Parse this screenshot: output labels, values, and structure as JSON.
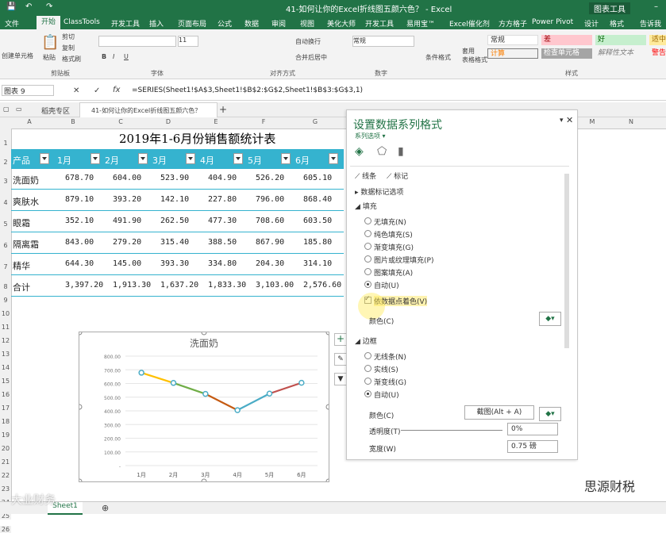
{
  "titlebar": {
    "doc_title": "41-如何让你的Excel折线图五颜六色？ - Excel",
    "context_group": "图表工具"
  },
  "tabs": [
    "文件",
    "开始",
    "ClassTools",
    "开发工具",
    "插入",
    "页面布局",
    "公式",
    "数据",
    "审阅",
    "视图",
    "美化大师",
    "开发工具",
    "易用宝™",
    "Excel催化剂",
    "方方格子",
    "Power Pivot",
    "设计",
    "格式",
    "告诉我"
  ],
  "ribbon": {
    "clipboard": {
      "cut": "剪切",
      "copy": "复制",
      "format_painter": "格式刷",
      "paste": "粘贴",
      "group": "剪贴板",
      "format_brush_left": "创建单元格"
    },
    "font": {
      "size": "11",
      "group": "字体"
    },
    "alignment": {
      "wrap": "自动换行",
      "merge": "合并后居中",
      "group": "对齐方式"
    },
    "number": {
      "format": "常规",
      "group": "数字"
    },
    "styles": {
      "cond": "条件格式",
      "table": "套用\n表格格式",
      "normal": "常规",
      "bad": "差",
      "good": "好",
      "neutral": "适中",
      "calc": "计算",
      "check": "检查单元格",
      "explain": "解释性文本",
      "warn": "警告",
      "group": "样式"
    }
  },
  "formula_bar": {
    "name_box": "图表 9",
    "fx": "fx",
    "formula": "=SERIES(Sheet1!$A$3,Sheet1!$B$2:$G$2,Sheet1!$B$3:$G$3,1)"
  },
  "doc_tabs": {
    "tab1": "稻壳专区",
    "tab2": "41-如何让你的Excel折线图五颜六色？"
  },
  "columns": [
    "A",
    "B",
    "C",
    "D",
    "E",
    "F",
    "G",
    "M",
    "N"
  ],
  "rows": [
    "1",
    "2",
    "3",
    "4",
    "5",
    "6",
    "7",
    "8",
    "9",
    "10",
    "11",
    "12",
    "13",
    "14",
    "15",
    "16",
    "17",
    "18",
    "19",
    "20",
    "21",
    "22",
    "23",
    "24",
    "25",
    "26"
  ],
  "table": {
    "title": "2019年1-6月份销售额统计表",
    "headers": [
      "产品",
      "1月",
      "2月",
      "3月",
      "4月",
      "5月",
      "6月"
    ],
    "rows": [
      [
        "洗面奶",
        "678.70",
        "604.00",
        "523.90",
        "404.90",
        "526.20",
        "605.10"
      ],
      [
        "爽肤水",
        "879.10",
        "393.20",
        "142.10",
        "227.80",
        "796.00",
        "868.40"
      ],
      [
        "眼霜",
        "352.10",
        "491.90",
        "262.50",
        "477.30",
        "708.60",
        "603.50"
      ],
      [
        "隔离霜",
        "843.00",
        "279.20",
        "315.40",
        "388.50",
        "867.90",
        "185.80"
      ],
      [
        "精华",
        "644.30",
        "145.00",
        "393.30",
        "334.80",
        "204.30",
        "314.10"
      ],
      [
        "合计",
        "3,397.20",
        "1,913.30",
        "1,637.20",
        "1,833.30",
        "3,103.00",
        "2,576.60"
      ]
    ]
  },
  "chart_data": {
    "type": "line",
    "title": "洗面奶",
    "categories": [
      "1月",
      "2月",
      "3月",
      "4月",
      "5月",
      "6月"
    ],
    "series": [
      {
        "name": "洗面奶",
        "values": [
          678.7,
          604.0,
          523.9,
          404.9,
          526.2,
          605.1
        ]
      }
    ],
    "yticks": [
      "800.00",
      "700.00",
      "600.00",
      "500.00",
      "400.00",
      "300.00",
      "200.00",
      "100.00",
      "-"
    ],
    "ylim": [
      0,
      800
    ],
    "segment_colors": [
      "#ffc000",
      "#70ad47",
      "#c55a11",
      "#4bacc6",
      "#c0504d"
    ]
  },
  "pane": {
    "title": "设置数据系列格式",
    "subtitle": "系列选项 ▾",
    "sub_tabs": {
      "line": "线条",
      "marker": "标记"
    },
    "label_options": "数据标记选项",
    "fill_section": "填充",
    "fill_options": [
      "无填充(N)",
      "纯色填充(S)",
      "渐变填充(G)",
      "图片或纹理填充(P)",
      "图案填充(A)",
      "自动(U)"
    ],
    "vary_colors": "依数据点着色(V)",
    "color_label": "颜色(C)",
    "border_section": "边框",
    "border_options": [
      "无线条(N)",
      "实线(S)",
      "渐变线(G)",
      "自动(U)"
    ],
    "border_color_label": "颜色(C)",
    "transparency_label": "透明度(T)",
    "transparency_value": "0%",
    "width_label": "宽度(W)",
    "width_value": "0.75 磅",
    "tooltip": "截图(Alt + A)"
  },
  "status": {
    "sheet": "Sheet1"
  },
  "watermarks": {
    "left": "大业财务",
    "right": "思源财税"
  }
}
